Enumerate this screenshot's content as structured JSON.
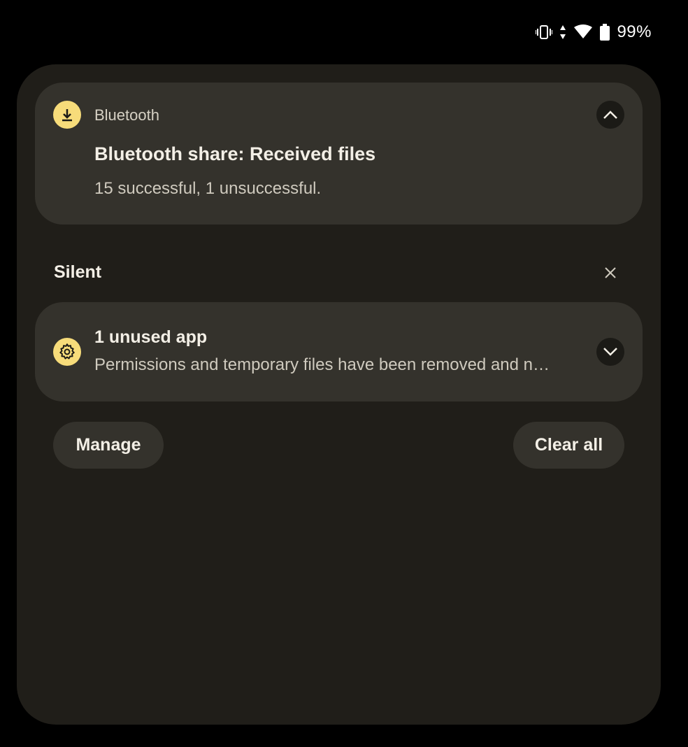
{
  "status_bar": {
    "icons": [
      "vibrate-icon",
      "data-arrows-icon",
      "wifi-6-icon",
      "battery-icon"
    ],
    "battery_percent": "99%"
  },
  "notifications": [
    {
      "app_icon": "download-icon",
      "app_name": "Bluetooth",
      "title": "Bluetooth share: Received files",
      "text": "15 successful, 1 unsuccessful.",
      "expand_icon": "chevron-up-icon"
    }
  ],
  "silent_section": {
    "header": "Silent",
    "dismiss_icon": "close-icon",
    "notifications": [
      {
        "app_icon": "gear-icon",
        "title": "1 unused app",
        "text": "Permissions and temporary files have been removed and n…",
        "expand_icon": "chevron-down-icon"
      }
    ]
  },
  "actions": {
    "manage_label": "Manage",
    "clear_all_label": "Clear all"
  },
  "colors": {
    "shade_bg": "#201e19",
    "card_bg": "#34322c",
    "icon_accent": "#f7dc7a",
    "text_primary": "#f3efe6",
    "text_secondary": "#cfcabe"
  }
}
